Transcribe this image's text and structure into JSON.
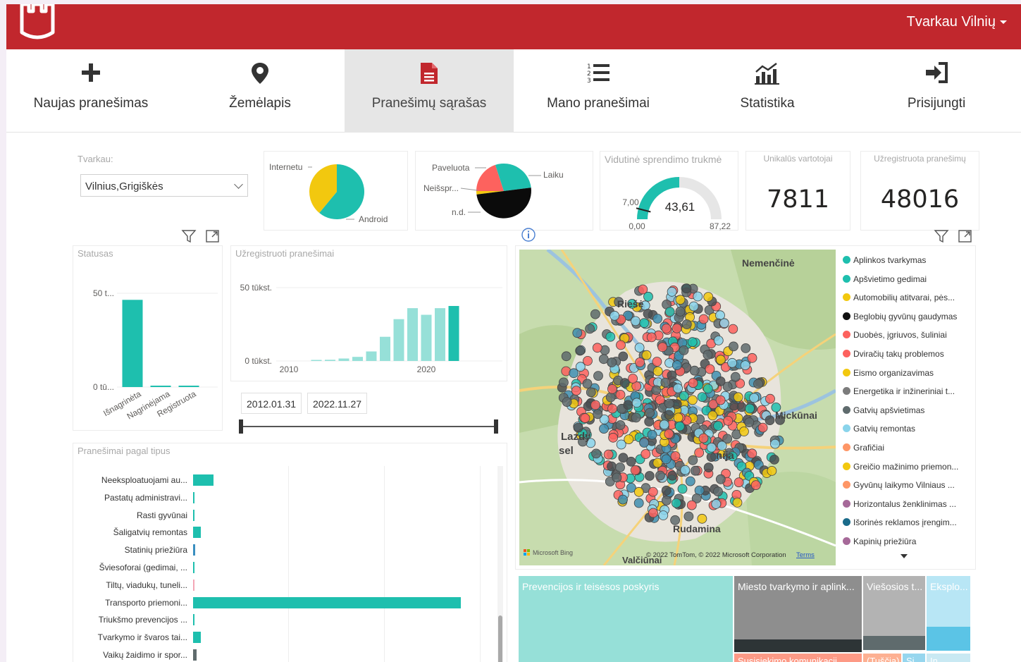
{
  "header": {
    "user_label": "Tvarkau Vilnių",
    "brand_color": "#c1272d"
  },
  "nav": {
    "items": [
      {
        "label": "Naujas pranešimas",
        "icon": "plus-icon"
      },
      {
        "label": "Žemėlapis",
        "icon": "map-pin-icon"
      },
      {
        "label": "Pranešimų sąrašas",
        "icon": "document-icon",
        "active": true
      },
      {
        "label": "Mano pranešimai",
        "icon": "numbered-list-icon"
      },
      {
        "label": "Statistika",
        "icon": "chart-icon"
      },
      {
        "label": "Prisijungti",
        "icon": "sign-in-icon"
      }
    ]
  },
  "slicer": {
    "title": "Tvarkau:",
    "value": "Vilnius,Grigiškės"
  },
  "platform_pie": {
    "labels": [
      "Internetu",
      "Android"
    ],
    "values": [
      39,
      61
    ],
    "colors": [
      "#f2c80f",
      "#1ebfae"
    ]
  },
  "timeliness_pie": {
    "labels": [
      "Paveluota",
      "Laiku",
      "Neišspr...",
      "n.d."
    ],
    "values": [
      20,
      28,
      2,
      50
    ],
    "colors": [
      "#fd625e",
      "#1ebfae",
      "#f2c80f",
      "#0b0b0b"
    ]
  },
  "gauge": {
    "title": "Vidutinė sprendimo trukmė",
    "value": 43.61,
    "value_label": "43,61",
    "min": 0,
    "max": 87.22,
    "target": 7.0,
    "min_label": "0,00",
    "max_label": "87,22",
    "target_label": "7,00"
  },
  "kpi_users": {
    "title": "Unikalūs vartotojai",
    "value": "7811"
  },
  "kpi_reports": {
    "title": "Užregistruota pranešimų",
    "value": "48016"
  },
  "status_chart": {
    "title": "Statusas",
    "y_ticks": [
      "50 t...",
      "0 tū..."
    ]
  },
  "registered_chart": {
    "title": "Užregistruoti pranešimai",
    "y_ticks": [
      "50 tūkst.",
      "0 tūkst."
    ],
    "x_ticks": [
      "2010",
      "2020"
    ]
  },
  "date_range": {
    "start": "2012.01.31",
    "end": "2022.11.27"
  },
  "types_chart": {
    "title": "Pranešimai pagal tipus"
  },
  "map": {
    "places": [
      "Nemenčinė",
      "Riešė",
      "Mickūnai",
      "Lazdy",
      "sel",
      "nija",
      "Rudamina",
      "Valčiūnai"
    ],
    "bing_label": "Microsoft Bing",
    "copyright": "© 2022 TomTom, © 2022 Microsoft Corporation",
    "terms": "Terms"
  },
  "map_legend": [
    {
      "label": "Aplinkos tvarkymas",
      "color": "#1ebfae"
    },
    {
      "label": "Apšvietimo gedimai",
      "color": "#1ebfae"
    },
    {
      "label": "Automobilių atitvarai, pės...",
      "color": "#f2c80f"
    },
    {
      "label": "Beglobių gyvūnų gaudymas",
      "color": "#111111"
    },
    {
      "label": "Duobės, įgriuvos, šuliniai",
      "color": "#fd625e"
    },
    {
      "label": "Dviračių takų problemos",
      "color": "#fd625e"
    },
    {
      "label": "Eismo organizavimas",
      "color": "#f2c80f"
    },
    {
      "label": "Energetika ir inžineriniai t...",
      "color": "#7c7c7c"
    },
    {
      "label": "Gatvių apšvietimas",
      "color": "#5f6b6d"
    },
    {
      "label": "Gatvių remontas",
      "color": "#8ad4eb"
    },
    {
      "label": "Grafičiai",
      "color": "#fe9666"
    },
    {
      "label": "Greičio mažinimo priemon...",
      "color": "#f2c80f"
    },
    {
      "label": "Gyvūnų laikymo Vilniaus ...",
      "color": "#fe9666"
    },
    {
      "label": "Horizontalus ženklinimas ...",
      "color": "#a66999"
    },
    {
      "label": "Išorinės reklamos įrengim...",
      "color": "#1a6b8a"
    },
    {
      "label": "Kapinių priežiūra",
      "color": "#a66999"
    }
  ],
  "chart_data": [
    {
      "type": "bar",
      "title": "Statusas",
      "categories": [
        "Išnagrinėta",
        "Nagrinėjama",
        "Registruota"
      ],
      "values": [
        46500,
        600,
        300
      ],
      "ylim": [
        0,
        55000
      ],
      "colors": [
        "#1ebfae"
      ]
    },
    {
      "type": "bar",
      "title": "Užregistruoti pranešimai",
      "x": [
        2012,
        2013,
        2014,
        2015,
        2016,
        2017,
        2018,
        2019,
        2020,
        2021,
        2022
      ],
      "values": [
        200,
        800,
        1700,
        2800,
        6500,
        16500,
        28500,
        36000,
        31500,
        36000,
        37500
      ],
      "ylim": [
        0,
        55000
      ],
      "colors": [
        "#96e0d8",
        "#1ebfae"
      ]
    },
    {
      "type": "bar",
      "title": "Pranešimai pagal tipus",
      "orientation": "horizontal",
      "categories": [
        "Neeksploatuojami au...",
        "Pastatų administravi...",
        "Rasti gyvūnai",
        "Šaligatvių remontas",
        "Statinių priežiūra",
        "Šviesoforai (gedimai, ...",
        "Tiltų, viadukų, tuneli...",
        "Transporto priemoni...",
        "Triukšmo prevencijos ...",
        "Tvarkymo ir švaros tai...",
        "Vaikų žaidimo ir spor..."
      ],
      "values": [
        1800,
        150,
        80,
        650,
        200,
        150,
        40,
        23500,
        150,
        650,
        300
      ],
      "bar_colors": [
        "#1ebfae",
        "#1ebfae",
        "#1ebfae",
        "#1ebfae",
        "#3a8fc0",
        "#1ebfae",
        "#f4a6b6",
        "#1ebfae",
        "#1ebfae",
        "#1ebfae",
        "#5f6b6d"
      ],
      "xlim": [
        0,
        26000
      ]
    },
    {
      "type": "treemap",
      "categories": [
        "Prevencijos ir teisėsos poskyris",
        "Miesto tvarkymo ir aplink...",
        "Viešosios t...",
        "Eksplo...",
        "Susisiekimo komunikacij...",
        "(Tuščia)",
        "Si...",
        "In..."
      ],
      "colors": [
        "#96e0d8",
        "#8e8e8e",
        "#b3b3b3",
        "#b8e6f5",
        "#fd9a86",
        "#fdb092",
        "#96d6ee",
        "#c9e9f3"
      ]
    }
  ]
}
